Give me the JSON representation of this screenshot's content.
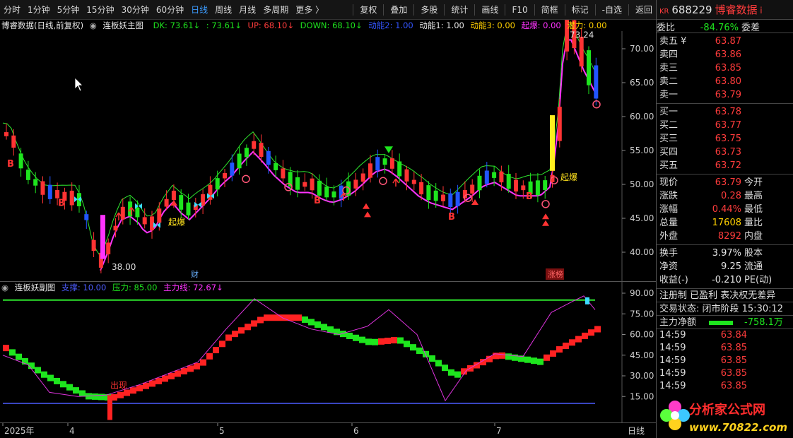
{
  "toolbar": {
    "periods": [
      "分时",
      "1分钟",
      "5分钟",
      "15分钟",
      "30分钟",
      "60分钟",
      "日线",
      "周线",
      "月线",
      "多周期",
      "更多 〉"
    ],
    "active_period": "日线",
    "tools": [
      "复权",
      "叠加",
      "多股",
      "统计",
      "画线",
      "F10",
      "简框",
      "标记",
      "-自选",
      "返回"
    ]
  },
  "main_legend": {
    "title": "博睿数据(日线,前复权)",
    "indicator": "连板妖主图",
    "dk": "DK: 73.61↓",
    "dk2": ": 73.61↓",
    "up": "UP: 68.10↓",
    "down": "DOWN: 68.10↓",
    "power2": "动能2: 1.00",
    "power1": "动能1: 1.00",
    "power3": "动能3: 0.00",
    "burst": "起爆: 0.00",
    "potential": "潜力: 0.00"
  },
  "main_axis": {
    "ticks": [
      "70.00",
      "65.00",
      "60.00",
      "55.00",
      "50.00",
      "45.00",
      "40.00"
    ],
    "high_label": "73.24",
    "low_label": "38.00",
    "signals": {
      "buy": "B",
      "burst": "起爆",
      "fin": "财",
      "limit": "涨榜"
    }
  },
  "sub_legend": {
    "indicator": "连板妖副图",
    "support": "支撑: 10.00",
    "pressure": "压力: 85.00",
    "main_line": "主力线: 72.67↓",
    "appear": "出现"
  },
  "sub_axis": {
    "ticks": [
      "90.00",
      "75.00",
      "60.00",
      "45.00",
      "30.00",
      "15.00"
    ]
  },
  "x_axis": {
    "labels": [
      "2025年",
      "4",
      "5",
      "6",
      "7"
    ],
    "period_tag": "日线"
  },
  "colors": {
    "up": "#ff3333",
    "down": "#1ee51e",
    "blue": "#2255ff",
    "magenta": "#ff33ff",
    "accent": "#3c9cff"
  },
  "panel": {
    "market": "KR",
    "code": "688229",
    "name": "博睿数据",
    "info": "i",
    "wei_label": "委比",
    "wei_value": "-84.76%",
    "wei_label2": "委差",
    "asks": [
      {
        "label": "卖五 ¥",
        "price": "63.87"
      },
      {
        "label": "卖四",
        "price": "63.86"
      },
      {
        "label": "卖三",
        "price": "63.85"
      },
      {
        "label": "卖二",
        "price": "63.80"
      },
      {
        "label": "卖一",
        "price": "63.79"
      }
    ],
    "bids": [
      {
        "label": "买一",
        "price": "63.78"
      },
      {
        "label": "买二",
        "price": "63.77"
      },
      {
        "label": "买三",
        "price": "63.75"
      },
      {
        "label": "买四",
        "price": "63.73"
      },
      {
        "label": "买五",
        "price": "63.72"
      }
    ],
    "stats": [
      {
        "label": "现价",
        "value": "63.79",
        "color": "red",
        "label2": "今开"
      },
      {
        "label": "涨跌",
        "value": "0.28",
        "color": "red",
        "label2": "最高"
      },
      {
        "label": "涨幅",
        "value": "0.44%",
        "color": "red",
        "label2": "最低"
      },
      {
        "label": "总量",
        "value": "17608",
        "color": "yellow",
        "label2": "量比"
      },
      {
        "label": "外盘",
        "value": "8292",
        "color": "red",
        "label2": "内盘"
      }
    ],
    "stats2": [
      {
        "label": "换手",
        "value": "3.97%",
        "color": "white",
        "label2": "股本"
      },
      {
        "label": "净资",
        "value": "9.25",
        "color": "white",
        "label2": "流通"
      },
      {
        "label": "收益(-)",
        "value": "-0.210",
        "color": "white",
        "label2": "PE(动)"
      }
    ],
    "notice": "注册制 已盈利 表决权无差异",
    "trade_status": "交易状态: 闭市阶段 15:30:12",
    "net_label": "主力净额",
    "net_value": "-758.1万",
    "ticks": [
      {
        "time": "14:59",
        "price": "63.84"
      },
      {
        "time": "14:59",
        "price": "63.85"
      },
      {
        "time": "14:59",
        "price": "63.85"
      },
      {
        "time": "14:59",
        "price": "63.85"
      },
      {
        "time": "14:59",
        "price": "63.85"
      }
    ],
    "logo_title": "分析家公式网",
    "logo_url": "www.70822.com"
  }
}
